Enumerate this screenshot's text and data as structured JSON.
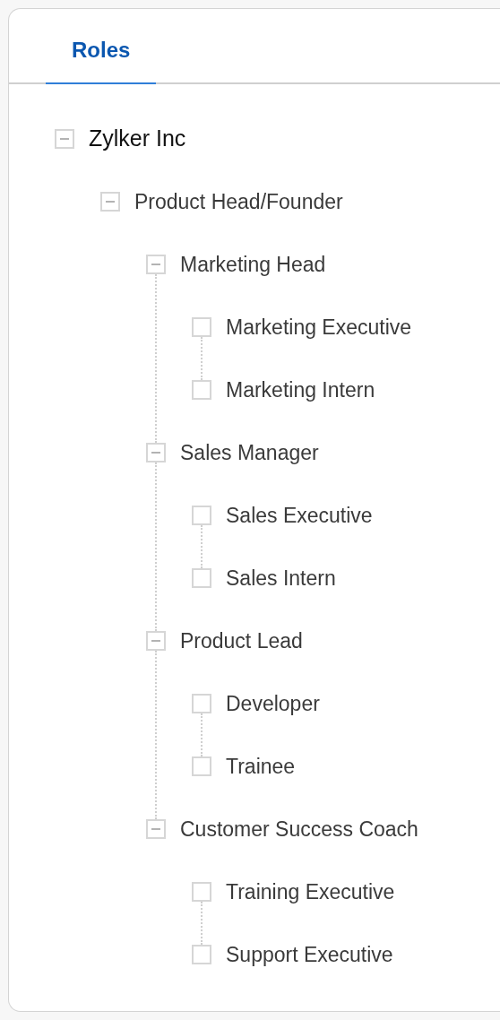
{
  "tabs": [
    {
      "label": "Roles",
      "selected": true
    }
  ],
  "tree": [
    {
      "label": "Zylker Inc",
      "expanded": true,
      "children": [
        {
          "label": "Product Head/Founder",
          "expanded": true,
          "children": [
            {
              "label": "Marketing Head",
              "expanded": true,
              "children": [
                {
                  "label": "Marketing Executive"
                },
                {
                  "label": "Marketing Intern"
                }
              ]
            },
            {
              "label": "Sales Manager",
              "expanded": true,
              "children": [
                {
                  "label": "Sales Executive"
                },
                {
                  "label": "Sales Intern"
                }
              ]
            },
            {
              "label": "Product Lead",
              "expanded": true,
              "children": [
                {
                  "label": "Developer"
                },
                {
                  "label": "Trainee"
                }
              ]
            },
            {
              "label": "Customer Success Coach",
              "expanded": true,
              "children": [
                {
                  "label": "Training Executive"
                },
                {
                  "label": "Support Executive"
                }
              ]
            }
          ]
        }
      ]
    }
  ]
}
